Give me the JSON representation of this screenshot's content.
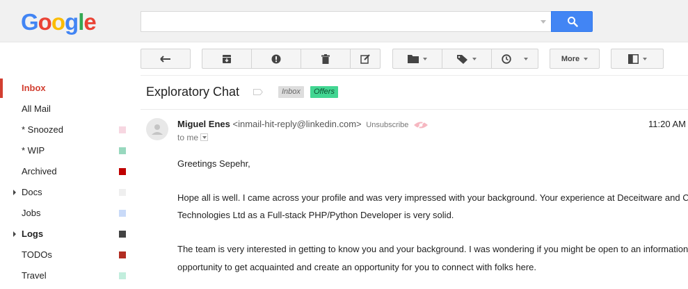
{
  "header": {
    "logo_letters": [
      "G",
      "o",
      "o",
      "g",
      "l",
      "e"
    ],
    "logo_colors": [
      "#4285f4",
      "#ea4335",
      "#fbbc05",
      "#4285f4",
      "#34a853",
      "#ea4335"
    ],
    "search_value": "",
    "search_icon": "search-icon"
  },
  "toolbar": {
    "back_icon": "back-arrow-icon",
    "archive_icon": "archive-icon",
    "spam_icon": "report-spam-icon",
    "delete_icon": "trash-icon",
    "edit_icon": "edit-icon",
    "move_icon": "folder-icon",
    "labels_icon": "tag-icon",
    "snooze_icon": "clock-icon",
    "more_label": "More",
    "layout_icon": "split-pane-icon"
  },
  "sidebar": {
    "items": [
      {
        "label": "Inbox",
        "active": true,
        "bold": true,
        "arrow": false,
        "color": null
      },
      {
        "label": "All Mail",
        "active": false,
        "bold": false,
        "arrow": false,
        "color": null
      },
      {
        "label": "* Snoozed",
        "active": false,
        "bold": false,
        "arrow": false,
        "color": "#f7d7e1"
      },
      {
        "label": "* WIP",
        "active": false,
        "bold": false,
        "arrow": false,
        "color": "#98d8be"
      },
      {
        "label": "Archived",
        "active": false,
        "bold": false,
        "arrow": false,
        "color": "#c00000"
      },
      {
        "label": "Docs",
        "active": false,
        "bold": false,
        "arrow": true,
        "color": "#efefef"
      },
      {
        "label": "Jobs",
        "active": false,
        "bold": false,
        "arrow": false,
        "color": "#c9daf8"
      },
      {
        "label": "Logs",
        "active": false,
        "bold": true,
        "arrow": true,
        "color": "#434343"
      },
      {
        "label": "TODOs",
        "active": false,
        "bold": false,
        "arrow": false,
        "color": "#b22d22"
      },
      {
        "label": "Travel",
        "active": false,
        "bold": false,
        "arrow": false,
        "color": "#c2eedd"
      }
    ]
  },
  "thread": {
    "subject": "Exploratory Chat",
    "labels": {
      "inbox": "Inbox",
      "offers": "Offers"
    }
  },
  "message": {
    "sender_name": "Miguel Enes",
    "sender_email": "<inmail-hit-reply@linkedin.com>",
    "unsubscribe": "Unsubscribe",
    "time": "11:20 AM",
    "to": "to me",
    "lines": [
      "Greetings Sepehr,",
      "Hope all is well. I came across your profile and was very impressed with your background. Your experience at Deceitware and Cre",
      "Technologies Ltd as a Full-stack PHP/Python Developer is very solid.",
      "The team is very interested in getting to know you and your background. I was wondering if you might be open to an information",
      "opportunity to get acquainted and create an opportunity for you to connect with folks here."
    ]
  }
}
